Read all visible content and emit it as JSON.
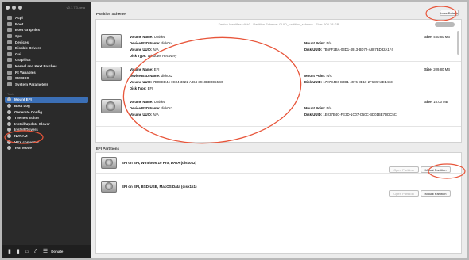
{
  "window": {
    "version": "v0.1.7.3-beta",
    "colors": {
      "sidebar_bg": "#2a2a2a",
      "selection": "#3b6fb6",
      "annotation": "#e8553a"
    }
  },
  "sidebar": {
    "items": [
      {
        "label": "Acpi",
        "icon": "table-icon"
      },
      {
        "label": "Boot",
        "icon": "table-icon"
      },
      {
        "label": "Boot Graphics",
        "icon": "table-icon"
      },
      {
        "label": "Cpu",
        "icon": "table-icon"
      },
      {
        "label": "Devices",
        "icon": "table-icon"
      },
      {
        "label": "Disable Drivers",
        "icon": "table-icon"
      },
      {
        "label": "Gui",
        "icon": "table-icon"
      },
      {
        "label": "Graphics",
        "icon": "table-icon"
      },
      {
        "label": "Kernel and Kext Patches",
        "icon": "table-icon"
      },
      {
        "label": "Rt Variables",
        "icon": "table-icon"
      },
      {
        "label": "SMBIOS",
        "icon": "table-icon"
      },
      {
        "label": "System Parameters",
        "icon": "table-icon"
      }
    ],
    "tools_label": "Tools",
    "tools": [
      {
        "label": "Mount EFI",
        "icon": "drive-icon",
        "selected": true
      },
      {
        "label": "Boot Log",
        "icon": "log-icon"
      },
      {
        "label": "Generate Config",
        "icon": "config-icon"
      },
      {
        "label": "Themes Editor",
        "icon": "theme-icon"
      },
      {
        "label": "Install/Update Clover",
        "icon": "download-icon"
      },
      {
        "label": "Install Drivers",
        "icon": "install-icon"
      },
      {
        "label": "NVRAM",
        "icon": "chip-icon"
      },
      {
        "label": "HEX converter",
        "icon": "hex-icon"
      },
      {
        "label": "Text Mode",
        "icon": "text-icon"
      }
    ],
    "bottom": {
      "donate_label": "Donate"
    }
  },
  "main": {
    "partition_scheme_title": "Partition Scheme",
    "less_details_label": "Less Details",
    "summary": "Device Identifier: disk0 - Partition Scheme: GUID_partition_scheme - Size: 500.28 GB",
    "partitions": [
      {
        "volume_name_label": "Volume Name:",
        "volume_name": "Untitled",
        "bsd_label": "Device BSD Name:",
        "bsd_name": "disk0s4",
        "uuid_label": "Volume UUID:",
        "uuid": "N/A",
        "disk_type_label": "Disk Type:",
        "disk_type": "Windows Recovery",
        "size_label": "Size:",
        "size": "450.80 MB",
        "mount_label": "Mount Point:",
        "mount_point": "N/A",
        "disk_uuid_label": "Disk UUID:",
        "disk_uuid": "7B6FF2BA-03D1-4913-BD72-A887BD32A1F4"
      },
      {
        "volume_name_label": "Volume Name:",
        "volume_name": "EFI",
        "bsd_label": "Device BSD Name:",
        "bsd_name": "disk0s2",
        "uuid_label": "Volume UUID:",
        "uuid": "7B0BED44-0C04-3621-A364-3918BD0E55C0",
        "disk_type_label": "Disk Type:",
        "disk_type": "EFI",
        "size_label": "Size:",
        "size": "209.80 MB",
        "mount_label": "Mount Point:",
        "mount_point": "N/A",
        "disk_uuid_label": "Disk UUID:",
        "disk_uuid": "1707D4E6-B0D1-4976-8E10-2F6E5A3EB413"
      },
      {
        "volume_name_label": "Volume Name:",
        "volume_name": "Untitled",
        "bsd_label": "Device BSD Name:",
        "bsd_name": "disk0s3",
        "uuid_label": "Volume UUID:",
        "uuid": "N/A",
        "size_label": "Size:",
        "size": "16.00 MB",
        "mount_label": "Mount Point:",
        "mount_point": "N/A",
        "disk_uuid_label": "Disk UUID:",
        "disk_uuid": "1E037B4C-FE3D-1C07-C50C-BD01BE7DDC5C"
      }
    ],
    "efi_title": "EFI Partitions",
    "efi_partitions": [
      {
        "title": "EFI on EFI, Windows 10 Pro, DATA (disk0s2)",
        "open_label": "Open Partition",
        "mount_label": "Mount Partition"
      },
      {
        "title": "EFI on EFI, BSD-USB, MacOS Data (disk1s1)",
        "open_label": "Open Partition",
        "mount_label": "Mount Partition"
      }
    ]
  }
}
